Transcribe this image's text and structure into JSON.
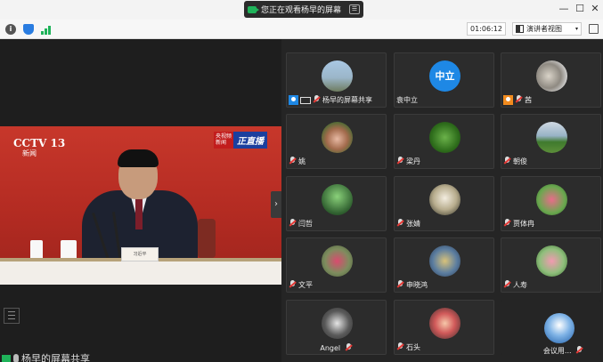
{
  "titlebar": {
    "share_notice": "您正在观看杨早的屏幕",
    "minimize": "—",
    "maximize": "☐",
    "close": "✕"
  },
  "toolbar": {
    "timer": "01:06:12",
    "view_label": "演讲者视图",
    "view_dropdown": "▾"
  },
  "main_video": {
    "channel_logo": "CCTV 13",
    "channel_sub": "新闻",
    "live_tag_small": "央视频新闻",
    "live_tag_big": "正直播",
    "nameplate": "习近平",
    "share_caption": "杨早的屏幕共享"
  },
  "gallery": {
    "tiles": [
      {
        "name": "杨早的屏幕共享",
        "avatar": "f1"
      },
      {
        "name": "袁中立",
        "avatar_text": "中立"
      },
      {
        "name": "茜",
        "avatar": "f2"
      },
      {
        "name": "姚",
        "avatar": "f3"
      },
      {
        "name": "梁丹",
        "avatar": "f4"
      },
      {
        "name": "朝俊",
        "avatar": "f5"
      },
      {
        "name": "闫哲",
        "avatar": "f6"
      },
      {
        "name": "张婧",
        "avatar": "f7"
      },
      {
        "name": "贾体冉",
        "avatar": "f8"
      },
      {
        "name": "文平",
        "avatar": "f9"
      },
      {
        "name": "申晓鸿",
        "avatar": "f10"
      },
      {
        "name": "人寿",
        "avatar": "f11"
      },
      {
        "name": "Angel",
        "avatar": "f12"
      },
      {
        "name": "石头",
        "avatar": "f13"
      },
      {
        "name": "会议用...",
        "avatar": "f14"
      }
    ]
  },
  "icons": {
    "info": "info-icon",
    "security": "shield-icon",
    "network": "signal-icon",
    "fullscreen": "fullscreen-icon"
  }
}
